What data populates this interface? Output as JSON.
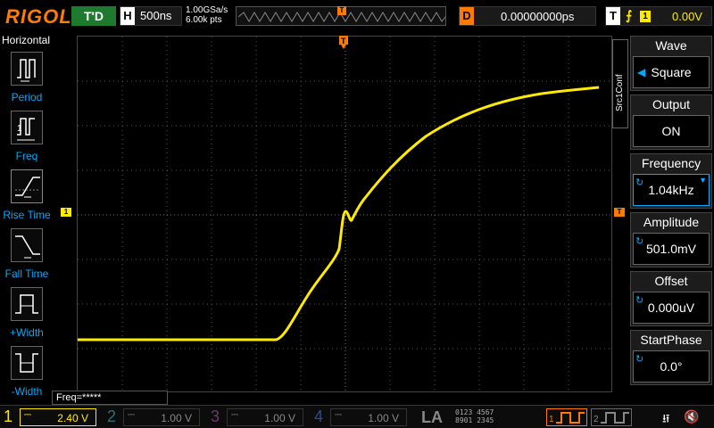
{
  "top": {
    "logo": "RIGOL",
    "run_status": "T'D",
    "horizontal_tag": "H",
    "timebase": "500ns",
    "sample_rate": "1.00GSa/s",
    "mem_depth": "6.00k pts",
    "trigger_pos_tag": "T",
    "delay_tag": "D",
    "delay_value": "0.00000000ps",
    "trigger_tag": "T",
    "trigger_edge": "⨍",
    "trigger_source": "1",
    "trigger_level": "0.00V"
  },
  "left_menu": {
    "title": "Horizontal",
    "items": [
      {
        "label": "Period",
        "icon": "period-icon"
      },
      {
        "label": "Freq",
        "icon": "freq-icon"
      },
      {
        "label": "Rise Time",
        "icon": "rise-time-icon"
      },
      {
        "label": "Fall Time",
        "icon": "fall-time-icon"
      },
      {
        "label": "+Width",
        "icon": "plus-width-icon"
      },
      {
        "label": "-Width",
        "icon": "minus-width-icon"
      }
    ]
  },
  "markers": {
    "ch1": "1",
    "trigger_level": "T",
    "trigger_position": "T"
  },
  "freq_readout": "Freq=*****",
  "right_panel": {
    "source_tab": "Src1Conf",
    "items": [
      {
        "title": "Wave",
        "value": "Square"
      },
      {
        "title": "Output",
        "value": "ON"
      },
      {
        "title": "Frequency",
        "value": "1.04kHz"
      },
      {
        "title": "Amplitude",
        "value": "501.0mV"
      },
      {
        "title": "Offset",
        "value": "0.000uV"
      },
      {
        "title": "StartPhase",
        "value": "0.0°"
      }
    ]
  },
  "bottom": {
    "channels": [
      {
        "num": "1",
        "scale": "2.40 V",
        "color": "#ffeb00",
        "active": true
      },
      {
        "num": "2",
        "scale": "1.00 V",
        "color": "#00c8d8",
        "active": false
      },
      {
        "num": "3",
        "scale": "1.00 V",
        "color": "#d040d0",
        "active": false
      },
      {
        "num": "4",
        "scale": "1.00 V",
        "color": "#2a7fff",
        "active": false
      }
    ],
    "la_label": "LA",
    "la_digits_top": "0123 4567",
    "la_digits_bottom": "8901 2345",
    "gen1_num": "1",
    "gen2_num": "2"
  },
  "colors": {
    "trace": "#ffeb00",
    "accent": "#ff7a00",
    "info": "#00aaff"
  }
}
